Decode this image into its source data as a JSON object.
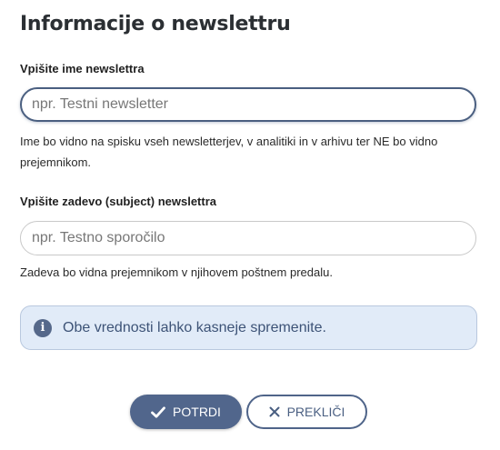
{
  "title": "Informacije o newslettru",
  "name_field": {
    "label": "Vpišite ime newslettra",
    "placeholder": "npr. Testni newsletter",
    "value": "",
    "help": "Ime bo vidno na spisku vseh newsletterjev, v analitiki in v arhivu ter NE bo vidno prejemnikom."
  },
  "subject_field": {
    "label": "Vpišite zadevo (subject) newslettra",
    "placeholder": "npr. Testno sporočilo",
    "value": "",
    "help": "Zadeva bo vidna prejemnikom v njihovem poštnem predalu."
  },
  "info": {
    "icon": "info-icon",
    "text": "Obe vrednosti lahko kasneje spremenite."
  },
  "buttons": {
    "confirm": {
      "label": "POTRDI",
      "icon": "check-icon"
    },
    "cancel": {
      "label": "PREKLIČI",
      "icon": "close-icon"
    }
  },
  "colors": {
    "primary": "#51668c",
    "info_background": "#e1ebf8",
    "info_text": "#3d5377"
  }
}
